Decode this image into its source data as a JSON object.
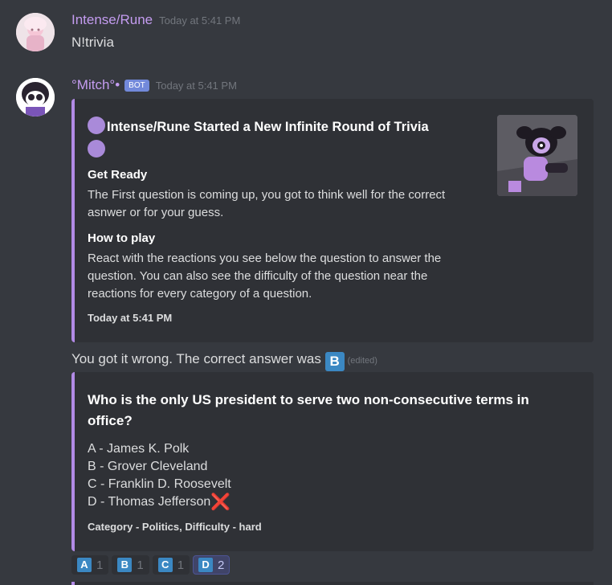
{
  "messages": [
    {
      "author": "Intense/Rune",
      "timestamp": "Today at 5:41 PM",
      "text": "N!trivia"
    },
    {
      "author": "°Mitch°•",
      "bot_tag": "BOT",
      "timestamp": "Today at 5:41 PM"
    }
  ],
  "embed1": {
    "title": "Intense/Rune Started a New Infinite Round of Trivia",
    "fields": [
      {
        "name": "Get Ready",
        "value_lines": [
          "The First question is coming up, you got to think well for the correct",
          "asnwer or for your guess."
        ]
      },
      {
        "name": "How to play",
        "value_lines": [
          "React with the reactions you see below the question to answer the",
          "question. You can also see the difficulty of the question near the",
          "reactions for every category of a question."
        ]
      }
    ],
    "footer": "Today at 5:41 PM",
    "accent_color": "#b28ae6"
  },
  "result": {
    "text": "You got it wrong. The correct answer was",
    "answer_emoji": "B",
    "edited": "(edited)"
  },
  "embed2": {
    "question_lines": [
      "Who is the only US president to serve two non-consecutive terms in",
      "office?"
    ],
    "options": [
      "A - James K. Polk",
      "B - Grover Cleveland",
      "C - Franklin D. Roosevelt",
      "D - Thomas Jefferson"
    ],
    "wrong_marker": "❌",
    "footer": "Category - Politics, Difficulty - hard"
  },
  "reactions": [
    {
      "emoji": "A",
      "count": "1"
    },
    {
      "emoji": "B",
      "count": "1"
    },
    {
      "emoji": "C",
      "count": "1"
    },
    {
      "emoji": "D",
      "count": "2"
    }
  ]
}
